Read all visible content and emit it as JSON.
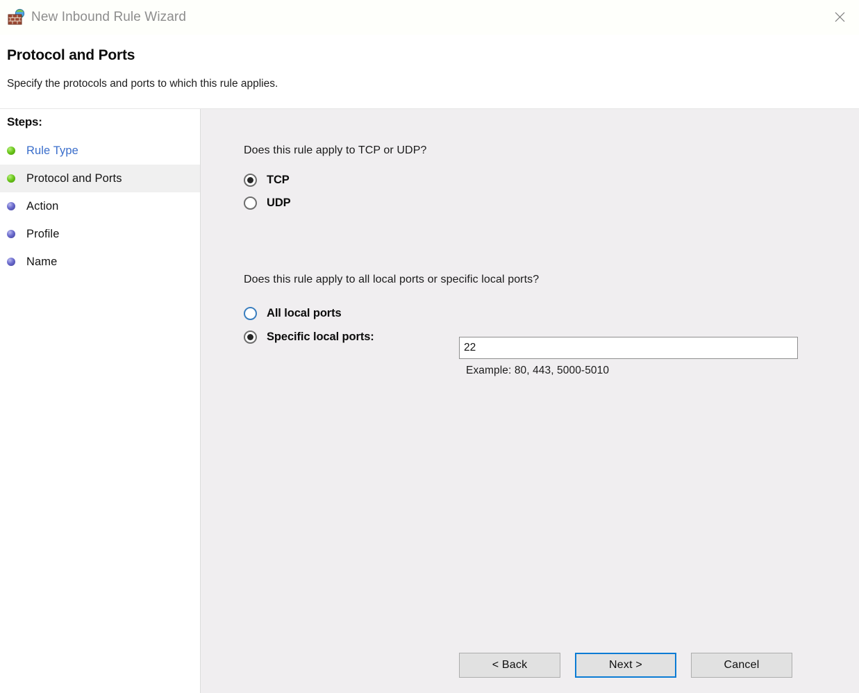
{
  "window": {
    "title": "New Inbound Rule Wizard",
    "icon": "firewall-globe-icon",
    "close_label": "close-icon"
  },
  "header": {
    "title": "Protocol and Ports",
    "subtitle": "Specify the protocols and ports to which this rule applies."
  },
  "sidebar": {
    "label": "Steps:",
    "items": [
      {
        "label": "Rule Type",
        "state": "completed-link"
      },
      {
        "label": "Protocol and Ports",
        "state": "current"
      },
      {
        "label": "Action",
        "state": "pending"
      },
      {
        "label": "Profile",
        "state": "pending"
      },
      {
        "label": "Name",
        "state": "pending"
      }
    ]
  },
  "main": {
    "protocol_question": "Does this rule apply to TCP or UDP?",
    "protocol_options": [
      {
        "label": "TCP",
        "selected": true
      },
      {
        "label": "UDP",
        "selected": false
      }
    ],
    "ports_question": "Does this rule apply to all local ports or specific local ports?",
    "ports_options": [
      {
        "label": "All local ports",
        "selected": false
      },
      {
        "label": "Specific local ports:",
        "selected": true
      }
    ],
    "ports_value": "22",
    "ports_placeholder": "",
    "example_text": "Example: 80, 443, 5000-5010"
  },
  "footer": {
    "back_label": "< Back",
    "next_label": "Next >",
    "cancel_label": "Cancel"
  },
  "colors": {
    "accent": "#0a7bd4",
    "link": "#3a6ecb",
    "step_done": "#6ec81e",
    "step_pending": "#6b6bcd",
    "content_bg": "#f0eef0",
    "button_bg": "#e1e1e1"
  }
}
